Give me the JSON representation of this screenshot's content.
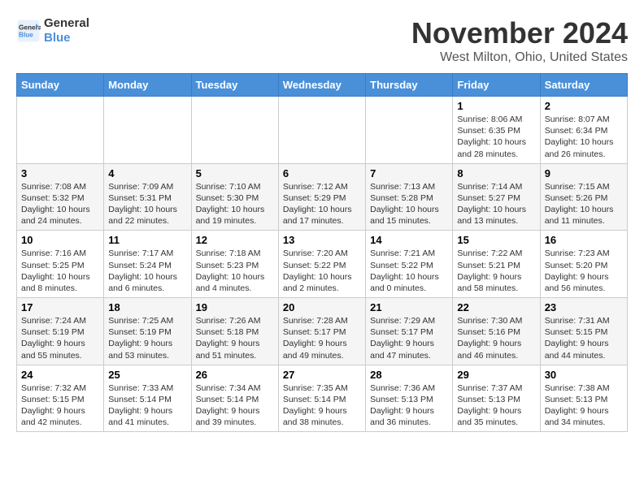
{
  "header": {
    "logo_line1": "General",
    "logo_line2": "Blue",
    "month": "November 2024",
    "location": "West Milton, Ohio, United States"
  },
  "weekdays": [
    "Sunday",
    "Monday",
    "Tuesday",
    "Wednesday",
    "Thursday",
    "Friday",
    "Saturday"
  ],
  "weeks": [
    [
      {
        "day": "",
        "info": ""
      },
      {
        "day": "",
        "info": ""
      },
      {
        "day": "",
        "info": ""
      },
      {
        "day": "",
        "info": ""
      },
      {
        "day": "",
        "info": ""
      },
      {
        "day": "1",
        "info": "Sunrise: 8:06 AM\nSunset: 6:35 PM\nDaylight: 10 hours and 28 minutes."
      },
      {
        "day": "2",
        "info": "Sunrise: 8:07 AM\nSunset: 6:34 PM\nDaylight: 10 hours and 26 minutes."
      }
    ],
    [
      {
        "day": "3",
        "info": "Sunrise: 7:08 AM\nSunset: 5:32 PM\nDaylight: 10 hours and 24 minutes."
      },
      {
        "day": "4",
        "info": "Sunrise: 7:09 AM\nSunset: 5:31 PM\nDaylight: 10 hours and 22 minutes."
      },
      {
        "day": "5",
        "info": "Sunrise: 7:10 AM\nSunset: 5:30 PM\nDaylight: 10 hours and 19 minutes."
      },
      {
        "day": "6",
        "info": "Sunrise: 7:12 AM\nSunset: 5:29 PM\nDaylight: 10 hours and 17 minutes."
      },
      {
        "day": "7",
        "info": "Sunrise: 7:13 AM\nSunset: 5:28 PM\nDaylight: 10 hours and 15 minutes."
      },
      {
        "day": "8",
        "info": "Sunrise: 7:14 AM\nSunset: 5:27 PM\nDaylight: 10 hours and 13 minutes."
      },
      {
        "day": "9",
        "info": "Sunrise: 7:15 AM\nSunset: 5:26 PM\nDaylight: 10 hours and 11 minutes."
      }
    ],
    [
      {
        "day": "10",
        "info": "Sunrise: 7:16 AM\nSunset: 5:25 PM\nDaylight: 10 hours and 8 minutes."
      },
      {
        "day": "11",
        "info": "Sunrise: 7:17 AM\nSunset: 5:24 PM\nDaylight: 10 hours and 6 minutes."
      },
      {
        "day": "12",
        "info": "Sunrise: 7:18 AM\nSunset: 5:23 PM\nDaylight: 10 hours and 4 minutes."
      },
      {
        "day": "13",
        "info": "Sunrise: 7:20 AM\nSunset: 5:22 PM\nDaylight: 10 hours and 2 minutes."
      },
      {
        "day": "14",
        "info": "Sunrise: 7:21 AM\nSunset: 5:22 PM\nDaylight: 10 hours and 0 minutes."
      },
      {
        "day": "15",
        "info": "Sunrise: 7:22 AM\nSunset: 5:21 PM\nDaylight: 9 hours and 58 minutes."
      },
      {
        "day": "16",
        "info": "Sunrise: 7:23 AM\nSunset: 5:20 PM\nDaylight: 9 hours and 56 minutes."
      }
    ],
    [
      {
        "day": "17",
        "info": "Sunrise: 7:24 AM\nSunset: 5:19 PM\nDaylight: 9 hours and 55 minutes."
      },
      {
        "day": "18",
        "info": "Sunrise: 7:25 AM\nSunset: 5:19 PM\nDaylight: 9 hours and 53 minutes."
      },
      {
        "day": "19",
        "info": "Sunrise: 7:26 AM\nSunset: 5:18 PM\nDaylight: 9 hours and 51 minutes."
      },
      {
        "day": "20",
        "info": "Sunrise: 7:28 AM\nSunset: 5:17 PM\nDaylight: 9 hours and 49 minutes."
      },
      {
        "day": "21",
        "info": "Sunrise: 7:29 AM\nSunset: 5:17 PM\nDaylight: 9 hours and 47 minutes."
      },
      {
        "day": "22",
        "info": "Sunrise: 7:30 AM\nSunset: 5:16 PM\nDaylight: 9 hours and 46 minutes."
      },
      {
        "day": "23",
        "info": "Sunrise: 7:31 AM\nSunset: 5:15 PM\nDaylight: 9 hours and 44 minutes."
      }
    ],
    [
      {
        "day": "24",
        "info": "Sunrise: 7:32 AM\nSunset: 5:15 PM\nDaylight: 9 hours and 42 minutes."
      },
      {
        "day": "25",
        "info": "Sunrise: 7:33 AM\nSunset: 5:14 PM\nDaylight: 9 hours and 41 minutes."
      },
      {
        "day": "26",
        "info": "Sunrise: 7:34 AM\nSunset: 5:14 PM\nDaylight: 9 hours and 39 minutes."
      },
      {
        "day": "27",
        "info": "Sunrise: 7:35 AM\nSunset: 5:14 PM\nDaylight: 9 hours and 38 minutes."
      },
      {
        "day": "28",
        "info": "Sunrise: 7:36 AM\nSunset: 5:13 PM\nDaylight: 9 hours and 36 minutes."
      },
      {
        "day": "29",
        "info": "Sunrise: 7:37 AM\nSunset: 5:13 PM\nDaylight: 9 hours and 35 minutes."
      },
      {
        "day": "30",
        "info": "Sunrise: 7:38 AM\nSunset: 5:13 PM\nDaylight: 9 hours and 34 minutes."
      }
    ]
  ]
}
